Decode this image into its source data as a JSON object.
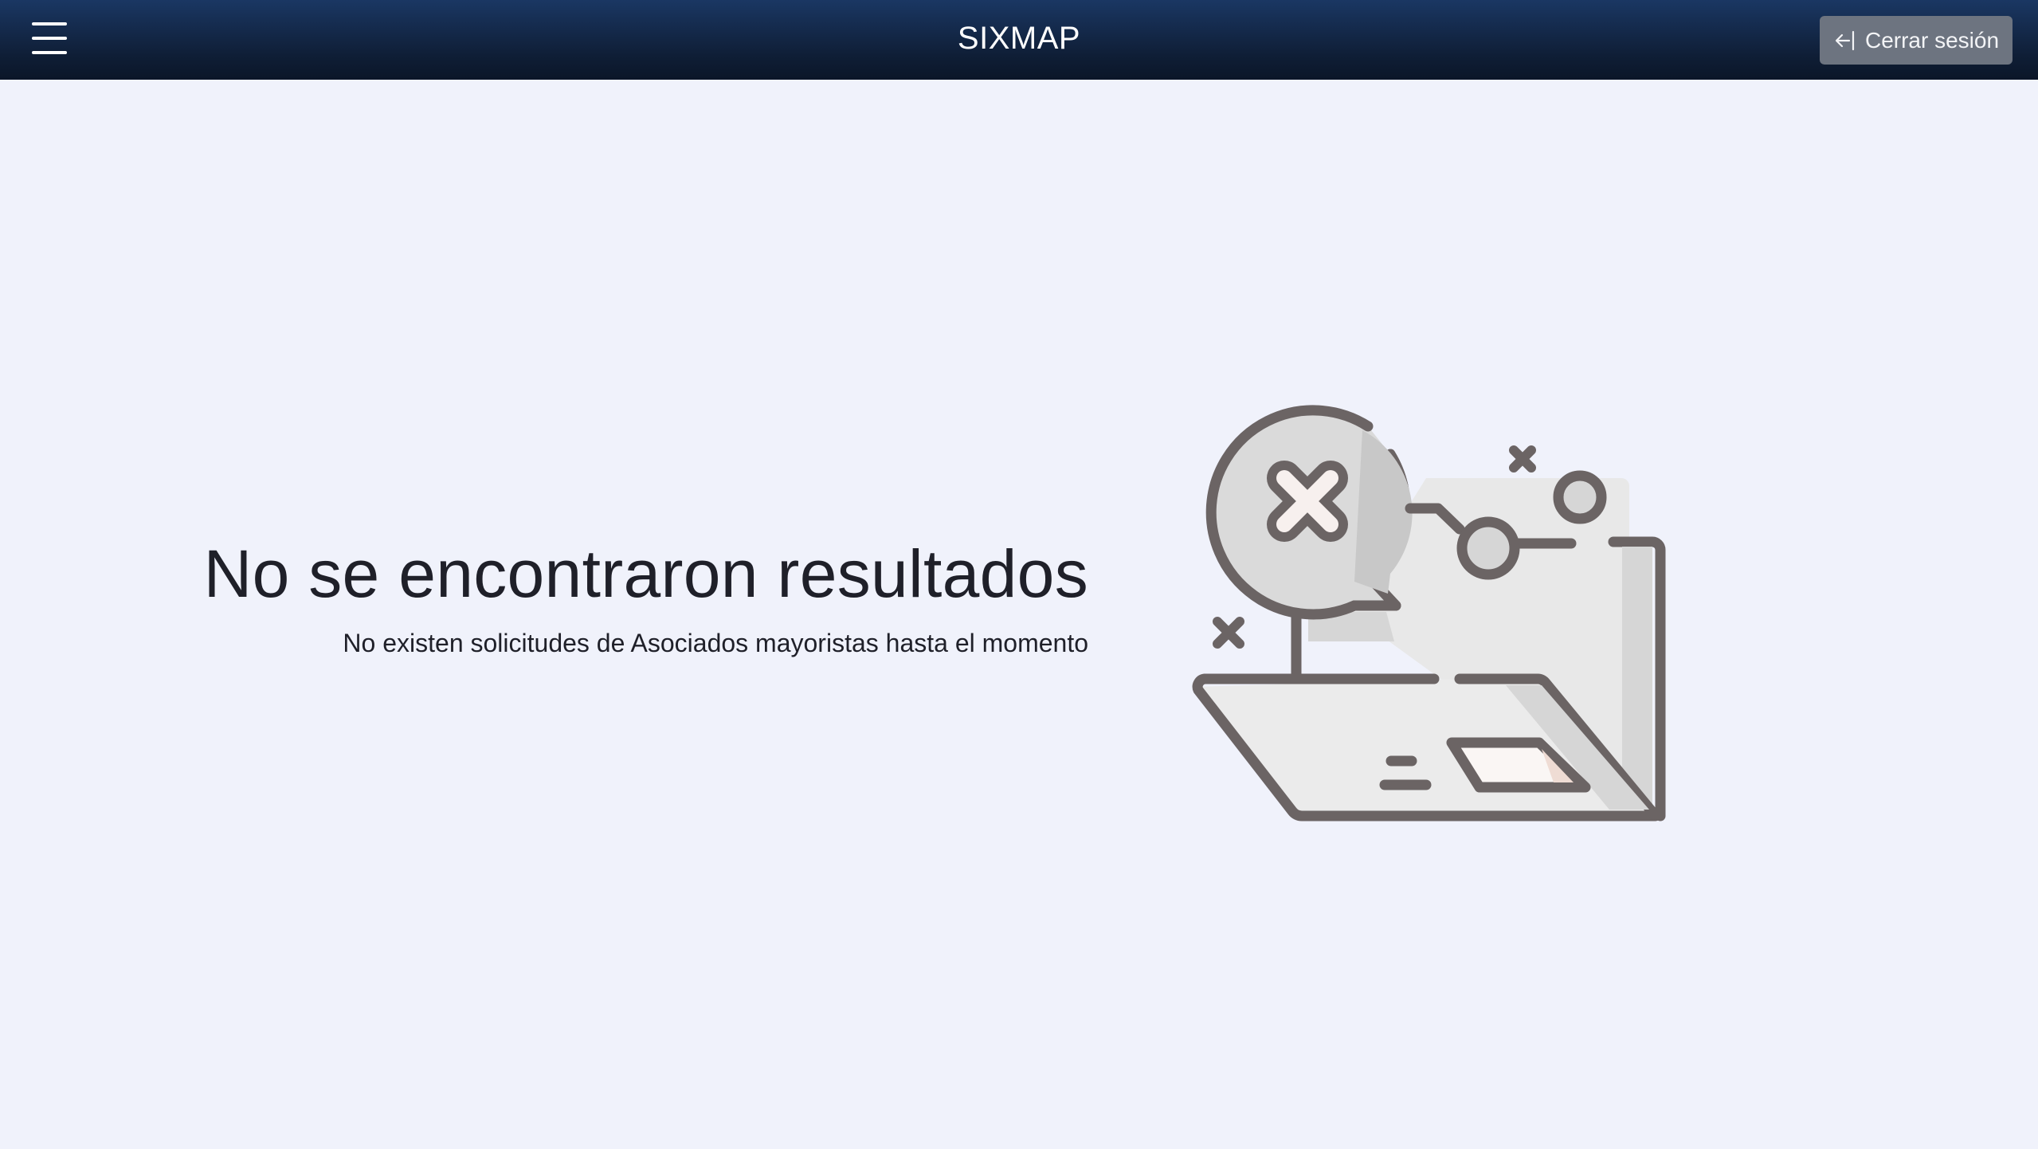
{
  "header": {
    "title": "SIXMAP",
    "menu_icon": "hamburger-menu-icon",
    "logout_icon": "logout-icon",
    "logout_label": "Cerrar sesión"
  },
  "empty_state": {
    "title": "No se encontraron resultados",
    "subtitle": "No existen solicitudes de Asociados mayoristas hasta el momento",
    "illustration": "empty-folder-no-results-illustration"
  },
  "colors": {
    "header_top": "#1a3763",
    "header_bottom": "#0b1628",
    "background": "#f0f2fb",
    "logout_button": "#6d7480",
    "text": "#1f2029",
    "illustration_stroke": "#6b6464",
    "illustration_fill": "#e8e8e8"
  }
}
